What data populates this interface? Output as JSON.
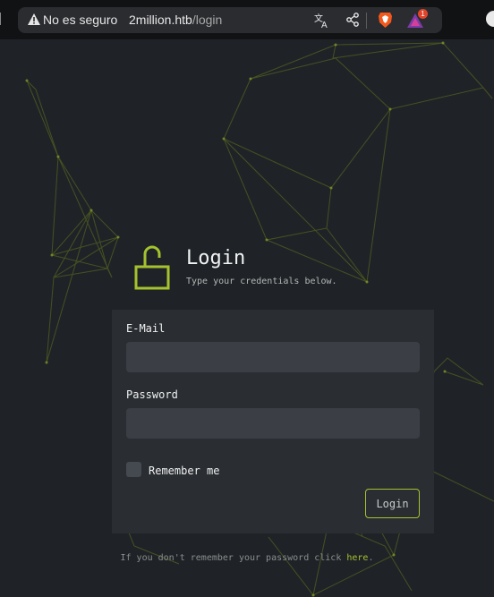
{
  "browser": {
    "security_label": "No es seguro",
    "url_host": "2million.htb",
    "url_path": "/login",
    "notification_count": "1"
  },
  "login": {
    "title": "Login",
    "subtitle": "Type your credentials below.",
    "email_label": "E-Mail",
    "email_value": "",
    "password_label": "Password",
    "password_value": "",
    "remember_label": "Remember me",
    "submit_label": "Login",
    "forgot_text": "If you don't remember your password click ",
    "forgot_link": "here",
    "forgot_end": "."
  },
  "colors": {
    "accent": "#a4c22e",
    "background": "#1f2328",
    "card": "#2a2e33",
    "input": "#3b3f45"
  }
}
